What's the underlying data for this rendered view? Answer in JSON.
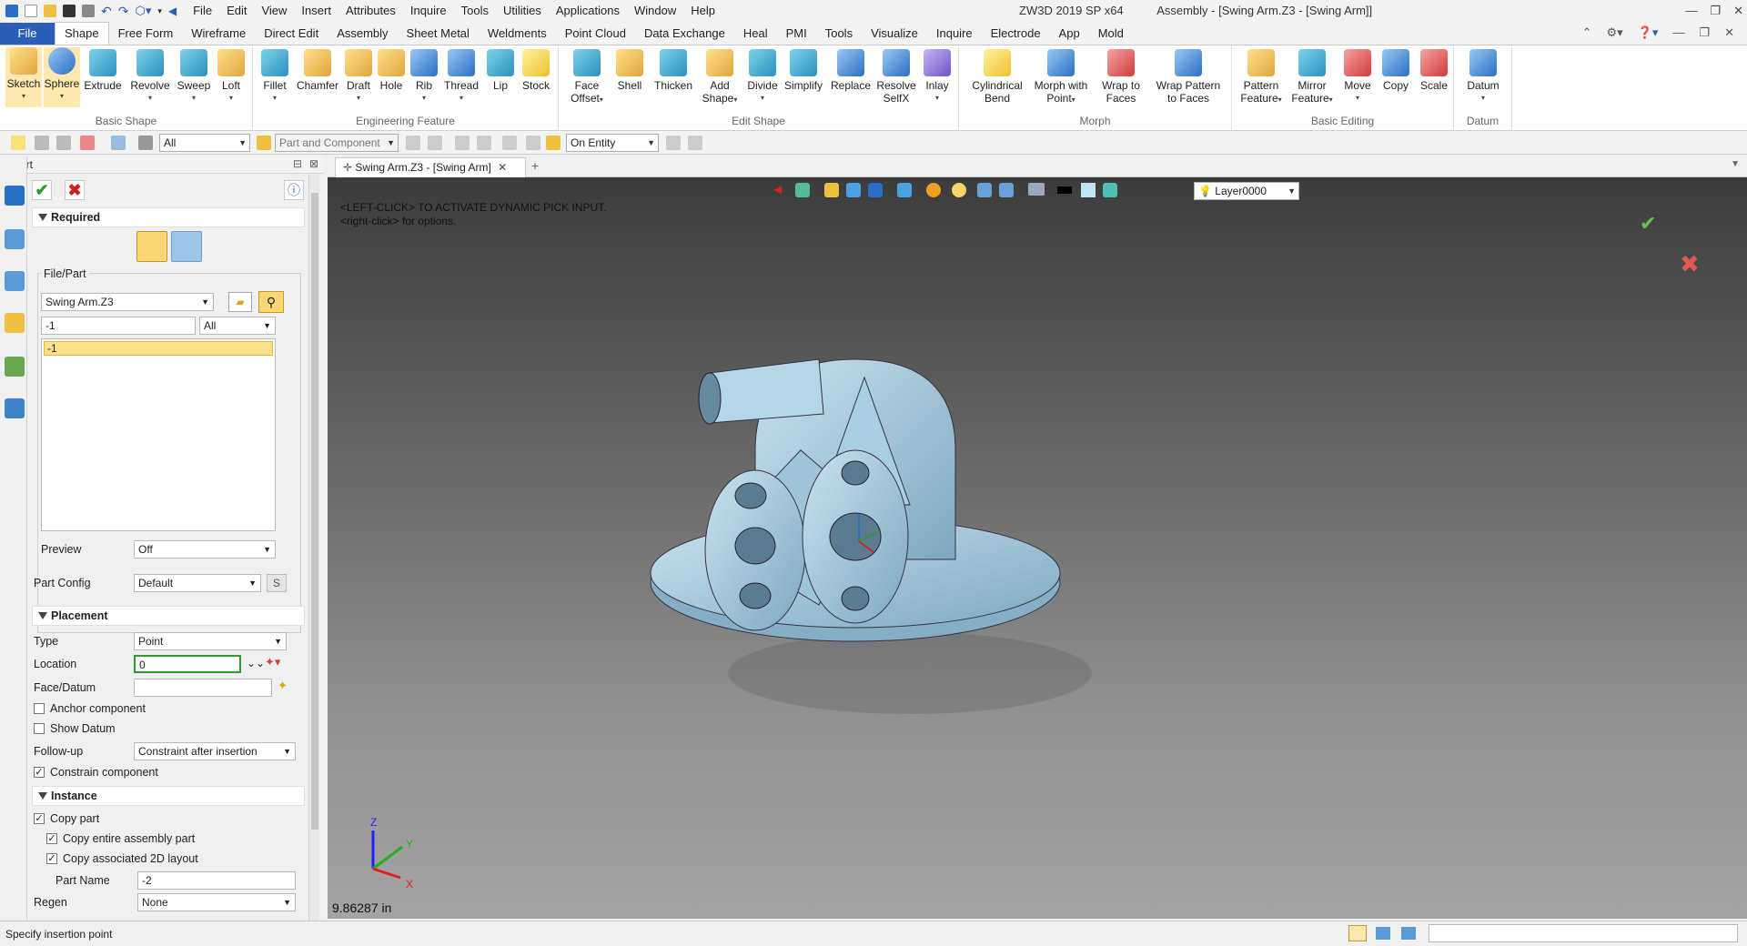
{
  "app": {
    "title": "ZW3D 2019 SP x64",
    "window_title": "Assembly - [Swing Arm.Z3 - [Swing Arm]]"
  },
  "menu": [
    "File",
    "Edit",
    "View",
    "Insert",
    "Attributes",
    "Inquire",
    "Tools",
    "Utilities",
    "Applications",
    "Window",
    "Help"
  ],
  "tabs": [
    "File",
    "Shape",
    "Free Form",
    "Wireframe",
    "Direct Edit",
    "Assembly",
    "Sheet Metal",
    "Weldments",
    "Point Cloud",
    "Data Exchange",
    "Heal",
    "PMI",
    "Tools",
    "Visualize",
    "Inquire",
    "Electrode",
    "App",
    "Mold"
  ],
  "active_tab": "Shape",
  "ribbon": {
    "groups": [
      {
        "label": "Basic Shape",
        "buttons": [
          "Sketch",
          "Sphere",
          "Extrude",
          "Revolve",
          "Sweep",
          "Loft"
        ]
      },
      {
        "label": "Engineering Feature",
        "buttons": [
          "Fillet",
          "Chamfer",
          "Draft",
          "Hole",
          "Rib",
          "Thread",
          "Lip",
          "Stock"
        ]
      },
      {
        "label": "Edit Shape",
        "buttons": [
          "Face Offset",
          "Shell",
          "Thicken",
          "Add Shape",
          "Divide",
          "Simplify",
          "Replace",
          "Resolve SelfX",
          "Inlay"
        ]
      },
      {
        "label": "Morph",
        "buttons": [
          "Cylindrical Bend",
          "Morph with Point",
          "Wrap to Faces",
          "Wrap Pattern to Faces"
        ]
      },
      {
        "label": "Basic Editing",
        "buttons": [
          "Pattern Feature",
          "Mirror Feature",
          "Move",
          "Copy",
          "Scale"
        ]
      },
      {
        "label": "Datum",
        "buttons": [
          "Datum"
        ]
      }
    ]
  },
  "toolbar2": {
    "filter": "All",
    "pick": "Part and Component",
    "snap": "On Entity"
  },
  "panel": {
    "header": "Insert",
    "required_label": "Required",
    "file_part_label": "File/Part",
    "file": "Swing Arm.Z3",
    "part_filter_value": "-1",
    "part_filter_type": "All",
    "part_list": [
      "-1"
    ],
    "preview_label": "Preview",
    "preview_value": "Off",
    "part_config_label": "Part Config",
    "part_config_value": "Default",
    "part_config_btn": "S",
    "placement_label": "Placement",
    "type_label": "Type",
    "type_value": "Point",
    "location_label": "Location",
    "location_value": "0",
    "face_datum_label": "Face/Datum",
    "anchor_label": "Anchor component",
    "show_datum_label": "Show Datum",
    "followup_label": "Follow-up",
    "followup_value": "Constraint after insertion",
    "constrain_label": "Constrain component",
    "instance_label": "Instance",
    "copy_part_label": "Copy part",
    "copy_entire_label": "Copy entire assembly part",
    "copy_2d_label": "Copy associated 2D layout",
    "part_name_label": "Part  Name",
    "part_name_value": "-2",
    "regen_label": "Regen",
    "regen_value": "None"
  },
  "document_tab": "Swing Arm.Z3 - [Swing Arm]",
  "viewport": {
    "hint1": "<LEFT-CLICK> TO ACTIVATE DYNAMIC PICK INPUT.",
    "hint2": "<right-click> for options.",
    "layer": "Layer0000",
    "measure": "9.86287 in",
    "axes": {
      "x": "X",
      "y": "Y",
      "z": "Z"
    }
  },
  "status": {
    "prompt": "Specify insertion point"
  }
}
